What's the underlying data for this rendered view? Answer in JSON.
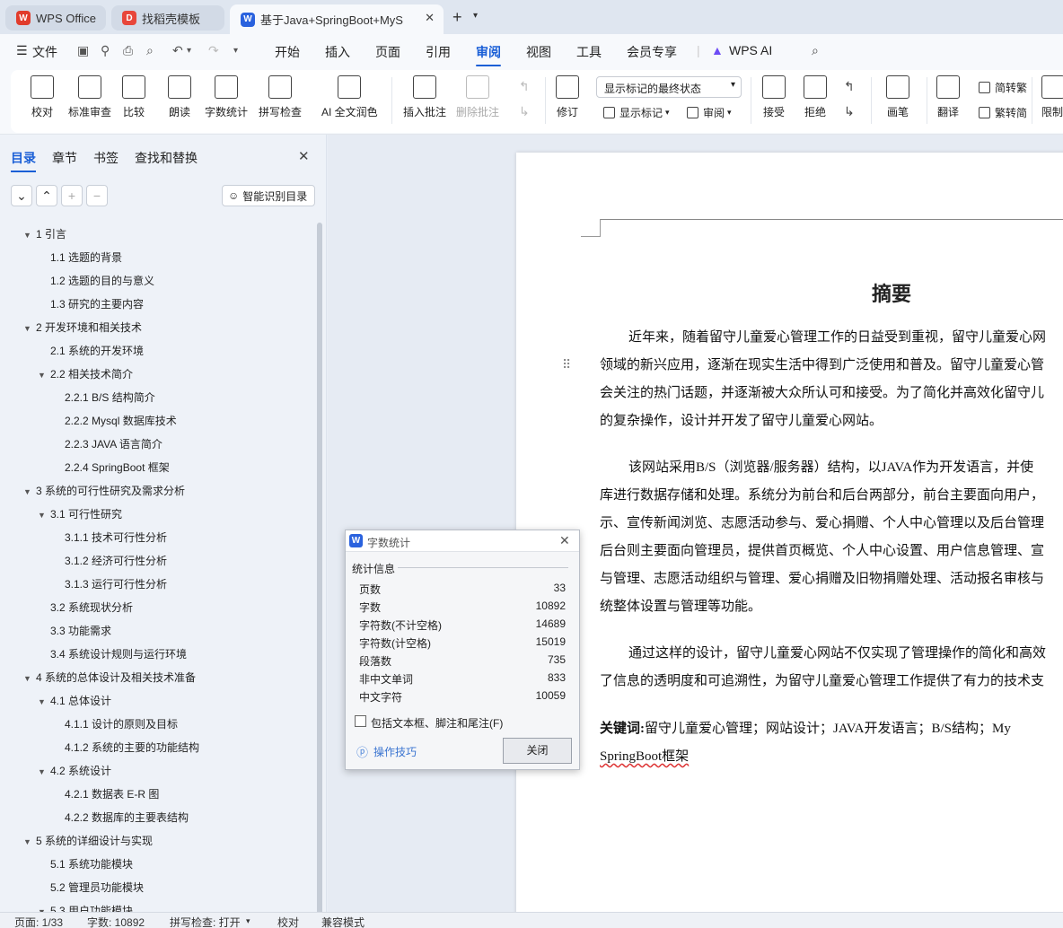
{
  "tabs": [
    {
      "label": "WPS Office"
    },
    {
      "label": "找稻壳模板"
    },
    {
      "label": "基于Java+SpringBoot+MyS"
    }
  ],
  "menu": {
    "file": "文件",
    "items": [
      "开始",
      "插入",
      "页面",
      "引用",
      "审阅",
      "视图",
      "工具",
      "会员专享"
    ],
    "ai": "WPS AI"
  },
  "ribbon": {
    "proofread": "校对",
    "std_review": "标准审查",
    "compare": "比较",
    "read": "朗读",
    "word_count": "字数统计",
    "spell": "拼写检查",
    "ai_polish": "AI 全文润色",
    "insert_comment": "插入批注",
    "delete_comment": "删除批注",
    "revise": "修订",
    "markup_select": "显示标记的最终状态",
    "show_markup": "显示标记",
    "review": "审阅",
    "accept": "接受",
    "reject": "拒绝",
    "pen": "画笔",
    "translate": "翻译",
    "to_trad": "简转繁",
    "to_simp": "繁转简",
    "restrict": "限制"
  },
  "sidebar": {
    "tabs": [
      "目录",
      "章节",
      "书签",
      "查找和替换"
    ],
    "smart_btn": "智能识别目录",
    "toc": [
      {
        "t": "1 引言",
        "lv": 0,
        "tw": "▼"
      },
      {
        "t": "1.1 选题的背景",
        "lv": 1
      },
      {
        "t": "1.2 选题的目的与意义",
        "lv": 1
      },
      {
        "t": "1.3 研究的主要内容",
        "lv": 1
      },
      {
        "t": "2  开发环境和相关技术",
        "lv": 0,
        "tw": "▼"
      },
      {
        "t": "2.1 系统的开发环境",
        "lv": 1
      },
      {
        "t": "2.2 相关技术简介",
        "lv": 1,
        "tw": "▼"
      },
      {
        "t": "2.2.1 B/S 结构简介",
        "lv": 2
      },
      {
        "t": "2.2.2 Mysql 数据库技术",
        "lv": 2
      },
      {
        "t": "2.2.3 JAVA 语言简介",
        "lv": 2
      },
      {
        "t": "2.2.4 SpringBoot 框架",
        "lv": 2
      },
      {
        "t": "3 系统的可行性研究及需求分析",
        "lv": 0,
        "tw": "▼"
      },
      {
        "t": "3.1 可行性研究",
        "lv": 1,
        "tw": "▼"
      },
      {
        "t": "3.1.1 技术可行性分析",
        "lv": 2
      },
      {
        "t": "3.1.2 经济可行性分析",
        "lv": 2
      },
      {
        "t": "3.1.3 运行可行性分析",
        "lv": 2
      },
      {
        "t": "3.2  系统现状分析",
        "lv": 1
      },
      {
        "t": "3.3 功能需求",
        "lv": 1
      },
      {
        "t": "3.4 系统设计规则与运行环境",
        "lv": 1
      },
      {
        "t": "4 系统的总体设计及相关技术准备",
        "lv": 0,
        "tw": "▼"
      },
      {
        "t": "4.1 总体设计",
        "lv": 1,
        "tw": "▼"
      },
      {
        "t": "4.1.1 设计的原则及目标",
        "lv": 2
      },
      {
        "t": "4.1.2 系统的主要的功能结构",
        "lv": 2
      },
      {
        "t": "4.2 系统设计",
        "lv": 1,
        "tw": "▼"
      },
      {
        "t": "4.2.1 数据表 E-R 图",
        "lv": 2
      },
      {
        "t": "4.2.2  数据库的主要表结构",
        "lv": 2
      },
      {
        "t": "5 系统的详细设计与实现",
        "lv": 0,
        "tw": "▼"
      },
      {
        "t": "5.1 系统功能模块",
        "lv": 1
      },
      {
        "t": "5.2 管理员功能模块",
        "lv": 1
      },
      {
        "t": "5.3 用户功能模块",
        "lv": 1,
        "tw": "▼"
      }
    ]
  },
  "doc": {
    "title": "摘要",
    "lines": [
      "近年来，随着留守儿童爱心管理工作的日益受到重视，留守儿童爱心网",
      "领域的新兴应用，逐渐在现实生活中得到广泛使用和普及。留守儿童爱心管",
      "会关注的热门话题，并逐渐被大众所认可和接受。为了简化并高效化留守儿",
      "的复杂操作，设计并开发了留守儿童爱心网站。",
      "该网站采用B/S（浏览器/服务器）结构，以JAVA作为开发语言，并使",
      "库进行数据存储和处理。系统分为前台和后台两部分，前台主要面向用户，",
      "示、宣传新闻浏览、志愿活动参与、爱心捐赠、个人中心管理以及后台管理",
      "后台则主要面向管理员，提供首页概览、个人中心设置、用户信息管理、宣",
      "与管理、志愿活动组织与管理、爱心捐赠及旧物捐赠处理、活动报名审核与",
      "统整体设置与管理等功能。",
      "通过这样的设计，留守儿童爱心网站不仅实现了管理操作的简化和高效",
      "了信息的透明度和可追溯性，为留守儿童爱心管理工作提供了有力的技术支"
    ],
    "kw_label": "关键词:",
    "kw_text": "留守儿童爱心管理；网站设计；JAVA开发语言；B/S结构；My",
    "kw_line2": "SpringBoot框架"
  },
  "dialog": {
    "title": "字数统计",
    "section": "统计信息",
    "rows": [
      {
        "k": "页数",
        "v": "33"
      },
      {
        "k": "字数",
        "v": "10892"
      },
      {
        "k": "字符数(不计空格)",
        "v": "14689"
      },
      {
        "k": "字符数(计空格)",
        "v": "15019"
      },
      {
        "k": "段落数",
        "v": "735"
      },
      {
        "k": "非中文单词",
        "v": "833"
      },
      {
        "k": "中文字符",
        "v": "10059"
      }
    ],
    "checkbox": "包括文本框、脚注和尾注(F)",
    "tips": "操作技巧",
    "close": "关闭"
  },
  "status": {
    "page": "页面: 1/33",
    "words": "字数: 10892",
    "spell": "拼写检查: 打开",
    "proof": "校对",
    "compat": "兼容模式"
  }
}
